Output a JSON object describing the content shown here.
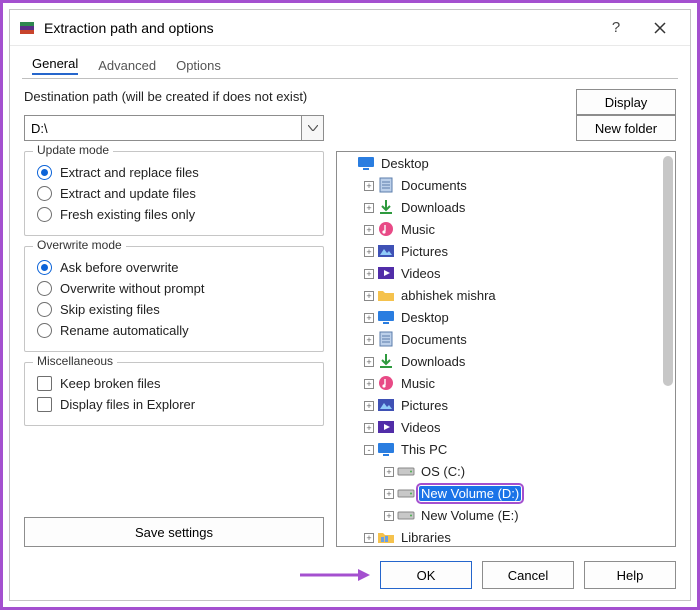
{
  "titlebar": {
    "title": "Extraction path and options"
  },
  "tabs": [
    {
      "label": "General",
      "active": true
    },
    {
      "label": "Advanced",
      "active": false
    },
    {
      "label": "Options",
      "active": false
    }
  ],
  "dest": {
    "label": "Destination path (will be created if does not exist)",
    "value": "D:\\",
    "display_btn": "Display",
    "new_folder_btn": "New folder"
  },
  "groups": {
    "update_mode": {
      "legend": "Update mode",
      "options": [
        {
          "label": "Extract and replace files",
          "checked": true
        },
        {
          "label": "Extract and update files",
          "checked": false
        },
        {
          "label": "Fresh existing files only",
          "checked": false
        }
      ]
    },
    "overwrite_mode": {
      "legend": "Overwrite mode",
      "options": [
        {
          "label": "Ask before overwrite",
          "checked": true
        },
        {
          "label": "Overwrite without prompt",
          "checked": false
        },
        {
          "label": "Skip existing files",
          "checked": false
        },
        {
          "label": "Rename automatically",
          "checked": false
        }
      ]
    },
    "misc": {
      "legend": "Miscellaneous",
      "options": [
        {
          "label": "Keep broken files",
          "checked": false
        },
        {
          "label": "Display files in Explorer",
          "checked": false
        }
      ]
    }
  },
  "save_settings": "Save settings",
  "tree": [
    {
      "depth": 0,
      "twisty": "",
      "icon": "desktop-icon",
      "label": "Desktop",
      "selected": false
    },
    {
      "depth": 1,
      "twisty": "+",
      "icon": "doc-icon",
      "label": "Documents",
      "selected": false
    },
    {
      "depth": 1,
      "twisty": "+",
      "icon": "download-icon",
      "label": "Downloads",
      "selected": false
    },
    {
      "depth": 1,
      "twisty": "+",
      "icon": "music-icon",
      "label": "Music",
      "selected": false
    },
    {
      "depth": 1,
      "twisty": "+",
      "icon": "pictures-icon",
      "label": "Pictures",
      "selected": false
    },
    {
      "depth": 1,
      "twisty": "+",
      "icon": "videos-icon",
      "label": "Videos",
      "selected": false
    },
    {
      "depth": 1,
      "twisty": "+",
      "icon": "folder-icon",
      "label": "abhishek mishra",
      "selected": false
    },
    {
      "depth": 1,
      "twisty": "+",
      "icon": "desktop2-icon",
      "label": "Desktop",
      "selected": false
    },
    {
      "depth": 1,
      "twisty": "+",
      "icon": "doc-icon",
      "label": "Documents",
      "selected": false
    },
    {
      "depth": 1,
      "twisty": "+",
      "icon": "download-icon",
      "label": "Downloads",
      "selected": false
    },
    {
      "depth": 1,
      "twisty": "+",
      "icon": "music-icon",
      "label": "Music",
      "selected": false
    },
    {
      "depth": 1,
      "twisty": "+",
      "icon": "pictures-icon",
      "label": "Pictures",
      "selected": false
    },
    {
      "depth": 1,
      "twisty": "+",
      "icon": "videos-icon",
      "label": "Videos",
      "selected": false
    },
    {
      "depth": 1,
      "twisty": "-",
      "icon": "pc-icon",
      "label": "This PC",
      "selected": false
    },
    {
      "depth": 2,
      "twisty": "+",
      "icon": "drive-icon",
      "label": "OS (C:)",
      "selected": false
    },
    {
      "depth": 2,
      "twisty": "+",
      "icon": "drive-icon",
      "label": "New Volume (D:)",
      "selected": true
    },
    {
      "depth": 2,
      "twisty": "+",
      "icon": "drive-icon",
      "label": "New Volume (E:)",
      "selected": false
    },
    {
      "depth": 1,
      "twisty": "+",
      "icon": "libraries-icon",
      "label": "Libraries",
      "selected": false
    }
  ],
  "buttons": {
    "ok": "OK",
    "cancel": "Cancel",
    "help": "Help"
  },
  "colors": {
    "accent": "#2566cc",
    "frame": "#a450cf",
    "selection": "#1a73e8"
  }
}
